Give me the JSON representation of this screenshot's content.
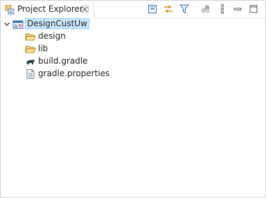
{
  "view": {
    "title": "Project Explorer",
    "icons": {
      "tab": "project-explorer-icon",
      "close": "close-icon",
      "collapse_all": "collapse-all-icon",
      "link_editor": "link-with-editor-icon",
      "filter": "filter-icon",
      "focus": "focus-on-active-task-icon",
      "menu": "view-menu-icon",
      "minimize": "minimize-icon",
      "maximize": "maximize-icon"
    }
  },
  "tree": {
    "project": {
      "label": "DesignCustUw",
      "icon": "gradle-project-icon",
      "expanded": true
    },
    "children": [
      {
        "label": "design",
        "icon": "folder-icon"
      },
      {
        "label": "lib",
        "icon": "folder-icon"
      },
      {
        "label": "build.gradle",
        "icon": "gradle-file-icon"
      },
      {
        "label": "gradle.properties",
        "icon": "properties-file-icon"
      }
    ]
  },
  "colors": {
    "selection_bg": "#cce8ff",
    "selection_border": "#99d1ff",
    "folder": "#e8b84a"
  }
}
